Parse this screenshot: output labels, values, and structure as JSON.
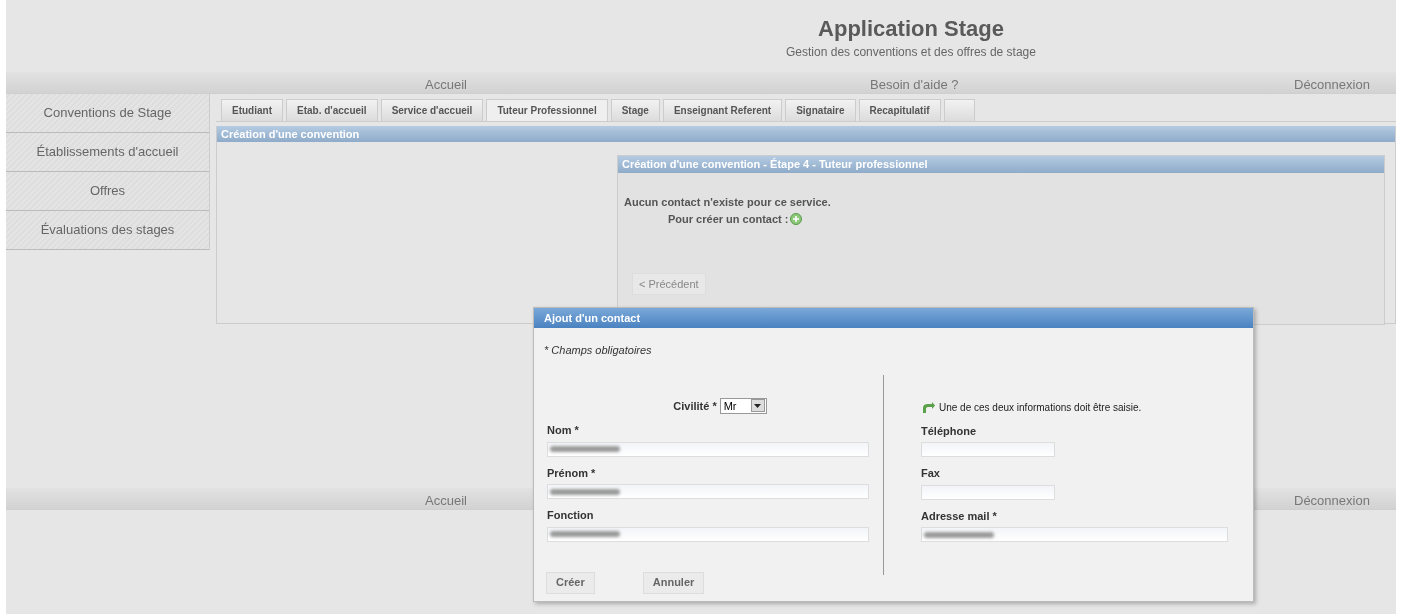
{
  "header": {
    "title": "Application Stage",
    "subtitle": "Gestion des conventions et des offres de stage"
  },
  "nav": [
    "Accueil",
    "Besoin d'aide ?",
    "Déconnexion"
  ],
  "sidebar": {
    "items": [
      {
        "label": "Conventions de Stage",
        "selected": false
      },
      {
        "label": "Établissements d'accueil",
        "selected": false
      },
      {
        "label": "Offres",
        "selected": false
      },
      {
        "label": "Évaluations des stages",
        "selected": false
      }
    ]
  },
  "tabs": [
    {
      "label": "Etudiant",
      "selected": false
    },
    {
      "label": "Etab. d'accueil",
      "selected": false
    },
    {
      "label": "Service d'accueil",
      "selected": false
    },
    {
      "label": "Tuteur Professionnel",
      "selected": true
    },
    {
      "label": "Stage",
      "selected": false
    },
    {
      "label": "Enseignant Referent",
      "selected": false
    },
    {
      "label": "Signataire",
      "selected": false
    },
    {
      "label": "Recapitulatif",
      "selected": false
    },
    {
      "selected": false
    }
  ],
  "main_title": "Création d'une convention",
  "step_panel": {
    "title": "Création d'une convention - Étape 4 - Tuteur professionnel",
    "message": "Aucun contact n'existe pour ce service.",
    "create_label": "Pour créer un contact :",
    "previous_button": "< Précédent"
  },
  "footer_nav": [
    "Accueil",
    "Déconnexion"
  ],
  "dialog": {
    "title": "Ajout d'un contact",
    "required_note": "* Champs obligatoires",
    "civilite": {
      "label": "Civilité *",
      "value": "Mr"
    },
    "left_fields": [
      {
        "label": "Nom *",
        "redacted": true
      },
      {
        "label": "Prénom *",
        "redacted": true
      },
      {
        "label": "Fonction",
        "redacted": true
      }
    ],
    "hint": "Une de ces deux informations doit être saisie.",
    "right_fields": [
      {
        "label": "Téléphone",
        "redacted": false,
        "wide": false
      },
      {
        "label": "Fax",
        "redacted": false,
        "wide": false
      },
      {
        "label": "Adresse mail *",
        "redacted": true,
        "wide": true
      }
    ],
    "buttons": [
      "Créer",
      "Annuler"
    ]
  }
}
